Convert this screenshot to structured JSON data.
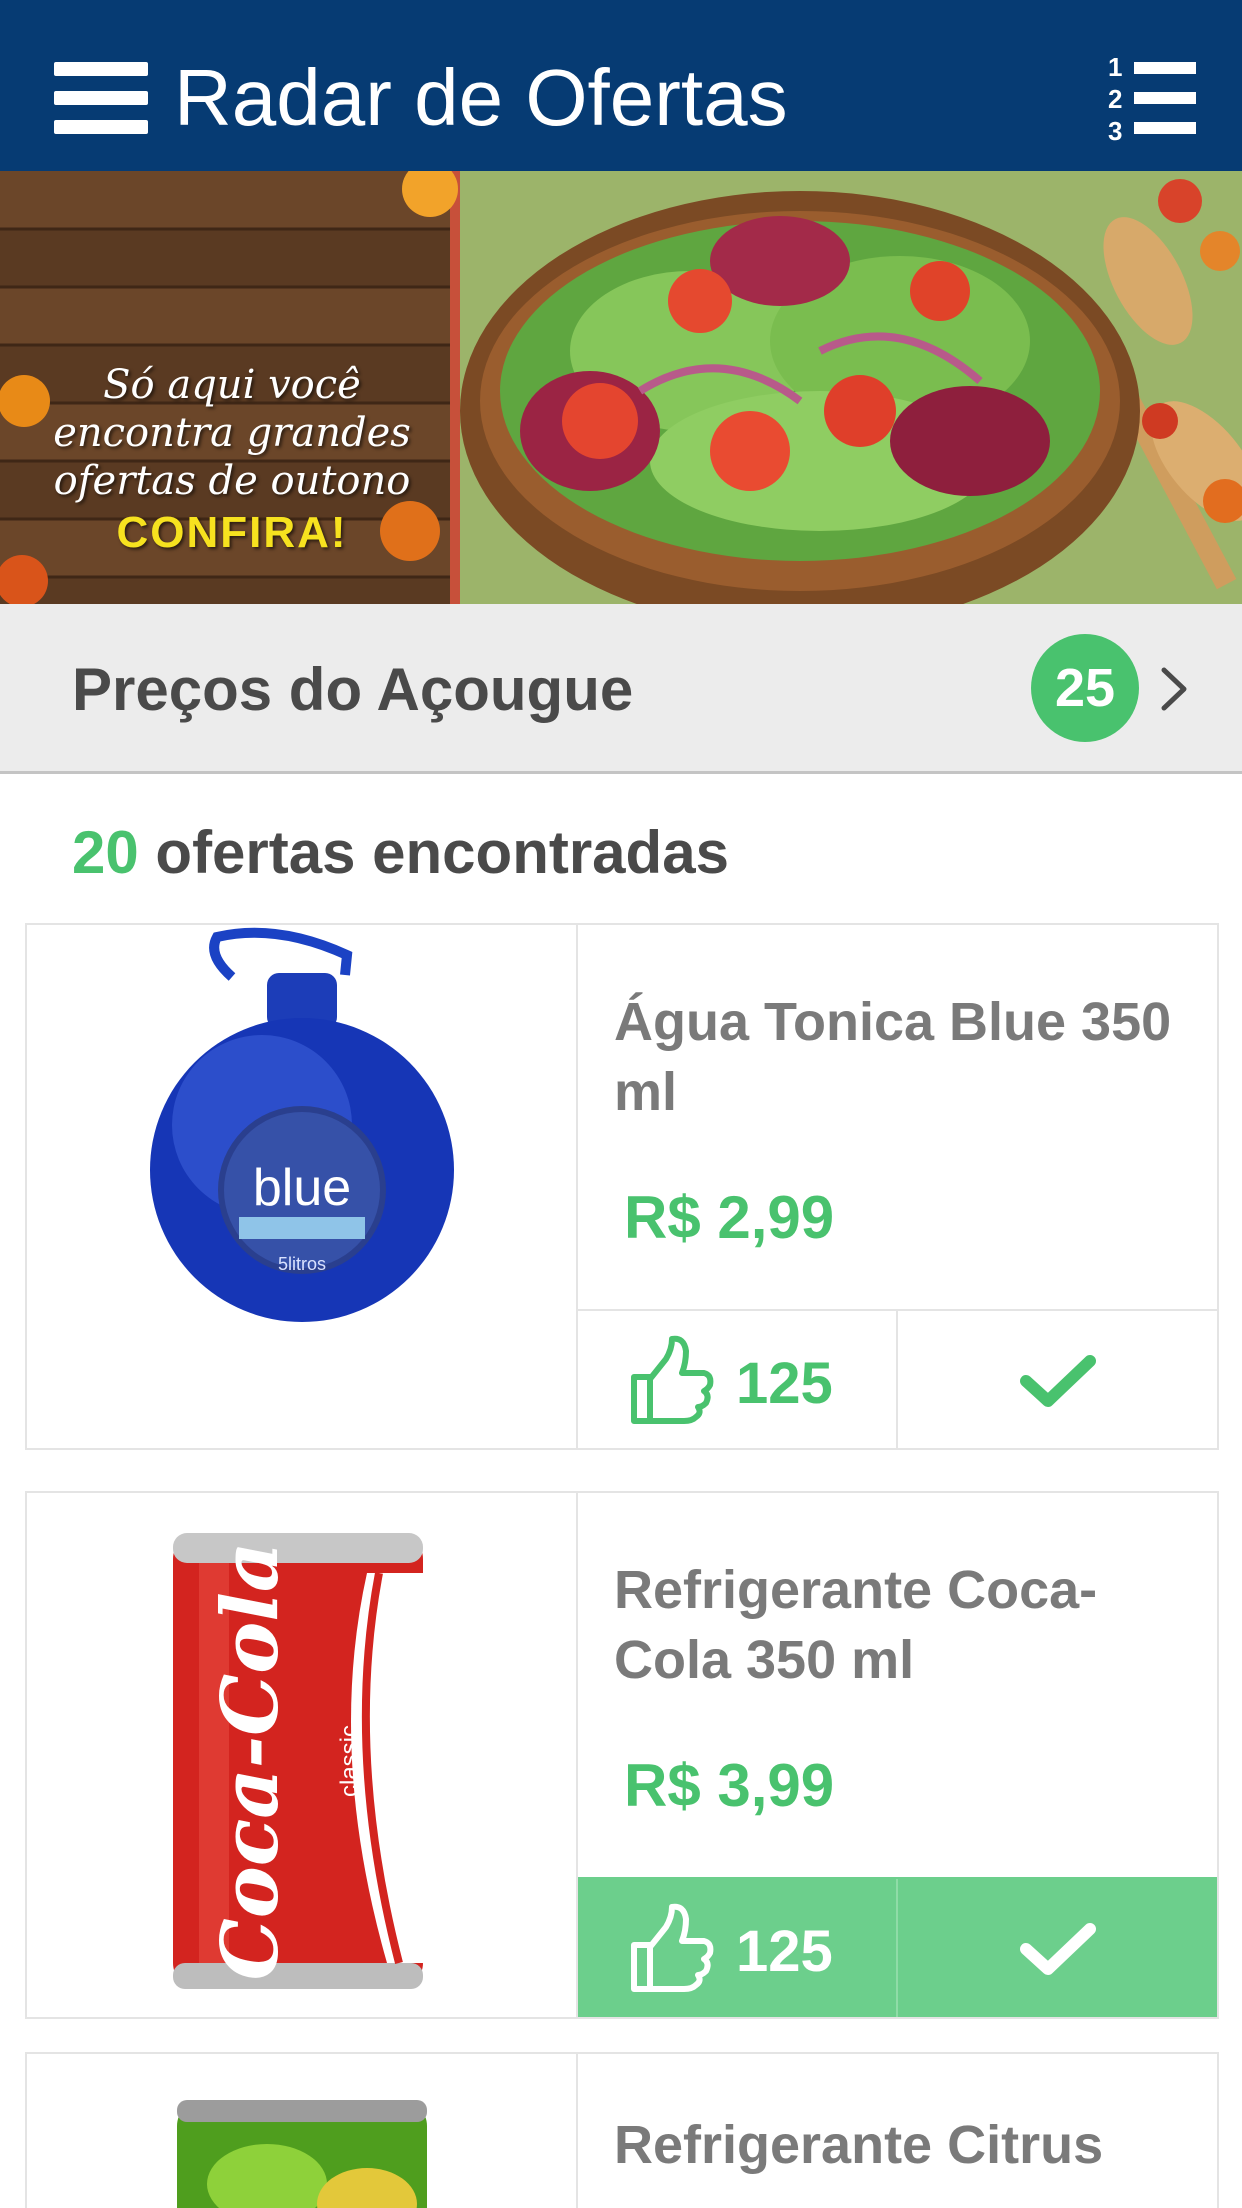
{
  "header": {
    "title": "Radar de Ofertas",
    "menu_icon": "hamburger-menu-icon",
    "ranking_icon": "numbered-list-icon",
    "background_color": "#063b73"
  },
  "banner": {
    "lines": [
      "Só aqui você",
      "encontra grandes",
      "ofertas de outono"
    ],
    "cta": "CONFIRA!"
  },
  "category": {
    "title": "Preços do Açougue",
    "count": "25",
    "chevron_icon": "chevron-right-icon"
  },
  "results": {
    "count": "20",
    "label": "ofertas encontradas"
  },
  "products": [
    {
      "name": "Água Tonica Blue 350 ml",
      "price": "R$ 2,99",
      "likes": "125",
      "image_text": "blue",
      "image_subtext": "5litros",
      "liked": false
    },
    {
      "name": "Refrigerante Coca-Cola 350 ml",
      "price": "R$ 3,99",
      "likes": "125",
      "image_text": "Coca-Cola",
      "image_subtext": "classic",
      "liked": true
    },
    {
      "name": "Refrigerante Citrus"
    }
  ],
  "colors": {
    "accent_green": "#49c26e",
    "active_green": "#6ccf8c",
    "text_gray": "#4a4a4a",
    "name_gray": "#7a7a7a"
  }
}
